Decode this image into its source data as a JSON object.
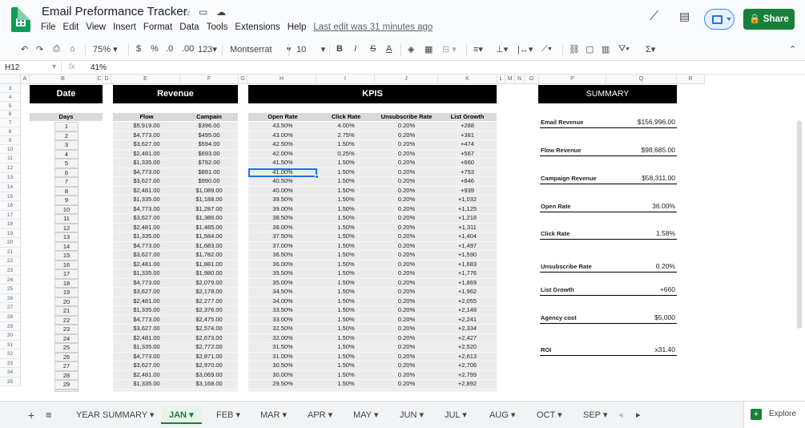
{
  "app": {
    "title": "Email Preformance Tracker",
    "menus": [
      "File",
      "Edit",
      "View",
      "Insert",
      "Format",
      "Data",
      "Tools",
      "Extensions",
      "Help"
    ],
    "last_edit": "Last edit was 31 minutes ago",
    "share_label": "Share"
  },
  "toolbar": {
    "zoom": "75%",
    "currency": "$",
    "percent": "%",
    "dec_less": ".0",
    "dec_more": ".00",
    "number_format": "123",
    "font": "Montserrat",
    "font_size": "10",
    "bold": "B",
    "italic": "I",
    "strike": "S",
    "text_color": "A"
  },
  "formula_bar": {
    "cell_ref": "H12",
    "fx": "fx",
    "value": "41%"
  },
  "columns": [
    "A",
    "B",
    "C",
    "D",
    "E",
    "F",
    "G",
    "H",
    "I",
    "J",
    "K",
    "L",
    "M",
    "N",
    "O",
    "P",
    "Q",
    "R"
  ],
  "row_numbers": [
    "3",
    "4",
    "5",
    "6",
    "7",
    "8",
    "9",
    "10",
    "11",
    "12",
    "13",
    "14",
    "15",
    "16",
    "17",
    "18",
    "19",
    "20",
    "21",
    "22",
    "23",
    "24",
    "25",
    "26",
    "27",
    "28",
    "29",
    "30",
    "31",
    "32",
    "33",
    "34",
    "35"
  ],
  "sections": {
    "date": "Date",
    "revenue": "Revenue",
    "kpis": "KPIS",
    "summary": "SUMMARY"
  },
  "headers": {
    "days": "Days",
    "flow": "Flow",
    "campaign": "Campain",
    "open_rate": "Open Rate",
    "click_rate": "Click Rate",
    "unsub_rate": "Unsubscribe Rate",
    "list_growth": "List Growth"
  },
  "table_rows": [
    [
      "1",
      "$5,919.00",
      "$396.00",
      "43.50%",
      "4.00%",
      "0.20%",
      "+288"
    ],
    [
      "2",
      "$4,773.00",
      "$495.00",
      "43.00%",
      "2.75%",
      "0.20%",
      "+381"
    ],
    [
      "3",
      "$3,627.00",
      "$594.00",
      "42.50%",
      "1.50%",
      "0.20%",
      "+474"
    ],
    [
      "4",
      "$2,481.00",
      "$693.00",
      "42.00%",
      "0.25%",
      "0.20%",
      "+567"
    ],
    [
      "5",
      "$1,335.00",
      "$792.00",
      "41.50%",
      "1.50%",
      "0.20%",
      "+660"
    ],
    [
      "6",
      "$4,773.00",
      "$891.00",
      "41.00%",
      "1.50%",
      "0.20%",
      "+753"
    ],
    [
      "7",
      "$3,627.00",
      "$990.00",
      "40.50%",
      "1.50%",
      "0.20%",
      "+846"
    ],
    [
      "8",
      "$2,481.00",
      "$1,089.00",
      "40.00%",
      "1.50%",
      "0.20%",
      "+939"
    ],
    [
      "9",
      "$1,335.00",
      "$1,188.00",
      "39.50%",
      "1.50%",
      "0.20%",
      "+1,032"
    ],
    [
      "10",
      "$4,773.00",
      "$1,287.00",
      "39.00%",
      "1.50%",
      "0.20%",
      "+1,125"
    ],
    [
      "11",
      "$3,627.00",
      "$1,386.00",
      "38.50%",
      "1.50%",
      "0.20%",
      "+1,218"
    ],
    [
      "12",
      "$2,481.00",
      "$1,485.00",
      "38.00%",
      "1.50%",
      "0.20%",
      "+1,311"
    ],
    [
      "13",
      "$1,335.00",
      "$1,584.00",
      "37.50%",
      "1.50%",
      "0.20%",
      "+1,404"
    ],
    [
      "14",
      "$4,773.00",
      "$1,683.00",
      "37.00%",
      "1.50%",
      "0.20%",
      "+1,497"
    ],
    [
      "15",
      "$3,627.00",
      "$1,782.00",
      "36.50%",
      "1.50%",
      "0.20%",
      "+1,590"
    ],
    [
      "16",
      "$2,481.00",
      "$1,881.00",
      "36.00%",
      "1.50%",
      "0.20%",
      "+1,683"
    ],
    [
      "17",
      "$1,335.00",
      "$1,980.00",
      "35.50%",
      "1.50%",
      "0.20%",
      "+1,776"
    ],
    [
      "18",
      "$4,773.00",
      "$2,079.00",
      "35.00%",
      "1.50%",
      "0.20%",
      "+1,869"
    ],
    [
      "19",
      "$3,627.00",
      "$2,178.00",
      "34.50%",
      "1.50%",
      "0.20%",
      "+1,962"
    ],
    [
      "20",
      "$2,481.00",
      "$2,277.00",
      "34.00%",
      "1.50%",
      "0.20%",
      "+2,055"
    ],
    [
      "21",
      "$1,335.00",
      "$2,376.00",
      "33.50%",
      "1.50%",
      "0.20%",
      "+2,148"
    ],
    [
      "22",
      "$4,773.00",
      "$2,475.00",
      "33.00%",
      "1.50%",
      "0.20%",
      "+2,241"
    ],
    [
      "23",
      "$3,627.00",
      "$2,574.00",
      "32.50%",
      "1.50%",
      "0.20%",
      "+2,334"
    ],
    [
      "24",
      "$2,481.00",
      "$2,673.00",
      "32.00%",
      "1.50%",
      "0.20%",
      "+2,427"
    ],
    [
      "25",
      "$1,335.00",
      "$2,772.00",
      "31.50%",
      "1.50%",
      "0.20%",
      "+2,520"
    ],
    [
      "26",
      "$4,773.00",
      "$2,871.00",
      "31.00%",
      "1.50%",
      "0.20%",
      "+2,613"
    ],
    [
      "27",
      "$3,627.00",
      "$2,970.00",
      "30.50%",
      "1.50%",
      "0.20%",
      "+2,706"
    ],
    [
      "28",
      "$2,481.00",
      "$3,069.00",
      "30.00%",
      "1.50%",
      "0.20%",
      "+2,799"
    ],
    [
      "29",
      "$1,335.00",
      "$3,168.00",
      "29.50%",
      "1.50%",
      "0.20%",
      "+2,892"
    ]
  ],
  "summary": [
    {
      "label": "Email Revenue",
      "value": "$156,996.00"
    },
    {
      "label": "Flow Revenue",
      "value": "$98,685.00"
    },
    {
      "label": "Campaign Revenue",
      "value": "$58,311.00"
    },
    {
      "label": "Open Rate",
      "value": "36.00%"
    },
    {
      "label": "Click Rate",
      "value": "1.58%"
    },
    {
      "label": "Unsubscribe Rate",
      "value": "0.20%"
    },
    {
      "label": "List Growth",
      "value": "+660"
    },
    {
      "label": "Agency cost",
      "value": "$5,000"
    },
    {
      "label": "ROI",
      "value": "x31.40"
    }
  ],
  "sheet_tabs": [
    "YEAR SUMMARY",
    "JAN",
    "FEB",
    "MAR",
    "APR",
    "MAY",
    "JUN",
    "JUL",
    "AUG",
    "OCT",
    "SEP"
  ],
  "active_tab": "JAN",
  "explore_label": "Explore",
  "colors": {
    "brand_green": "#188038",
    "selection_blue": "#1a73e8",
    "header_black": "#000000",
    "header_grey": "#d9d9d9"
  }
}
